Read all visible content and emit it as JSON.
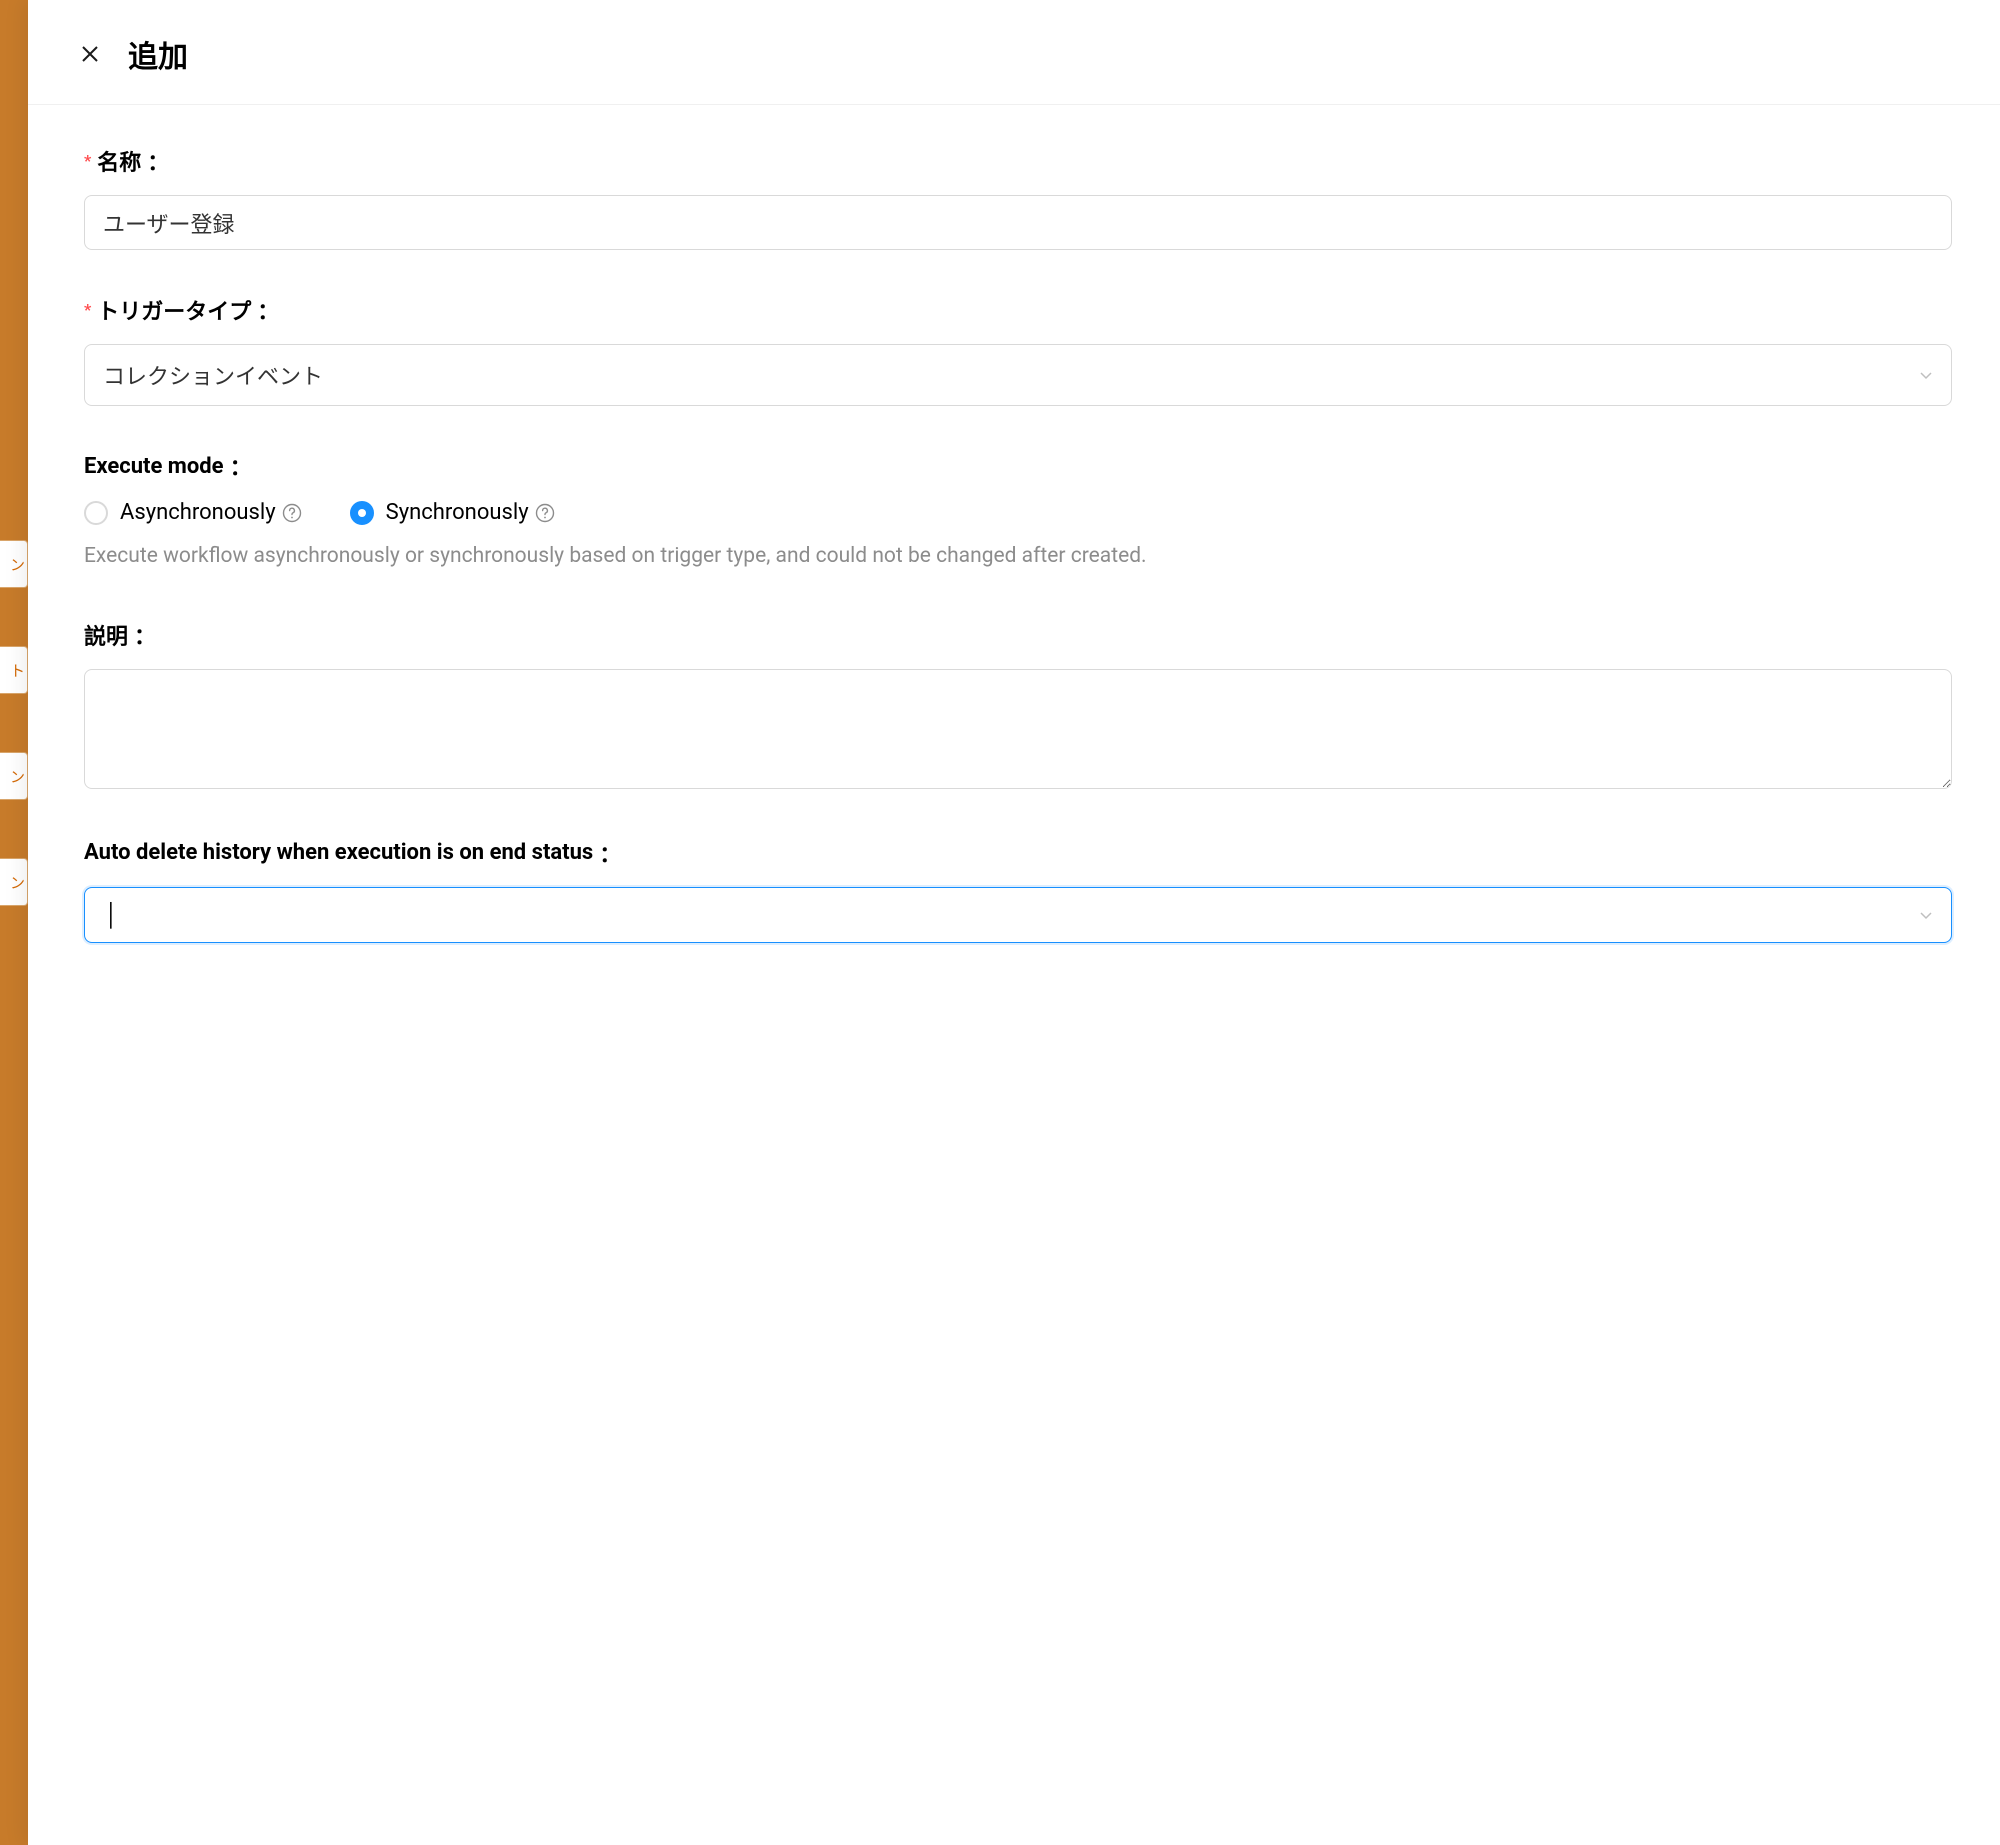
{
  "drawer": {
    "title": "追加"
  },
  "form": {
    "name": {
      "label": "名称",
      "value": "ユーザー登録"
    },
    "trigger_type": {
      "label": "トリガータイプ",
      "value": "コレクションイベント"
    },
    "execute_mode": {
      "label": "Execute mode",
      "options": {
        "async": "Asynchronously",
        "sync": "Synchronously"
      },
      "help": "Execute workflow asynchronously or synchronously based on trigger type, and could not be changed after created."
    },
    "description": {
      "label": "説明",
      "value": ""
    },
    "auto_delete": {
      "label": "Auto delete history when execution is on end status",
      "value": ""
    }
  },
  "backdrop": {
    "tag1": "ン",
    "tag2": "ト",
    "tag3": "ン",
    "tag4": "ン"
  }
}
